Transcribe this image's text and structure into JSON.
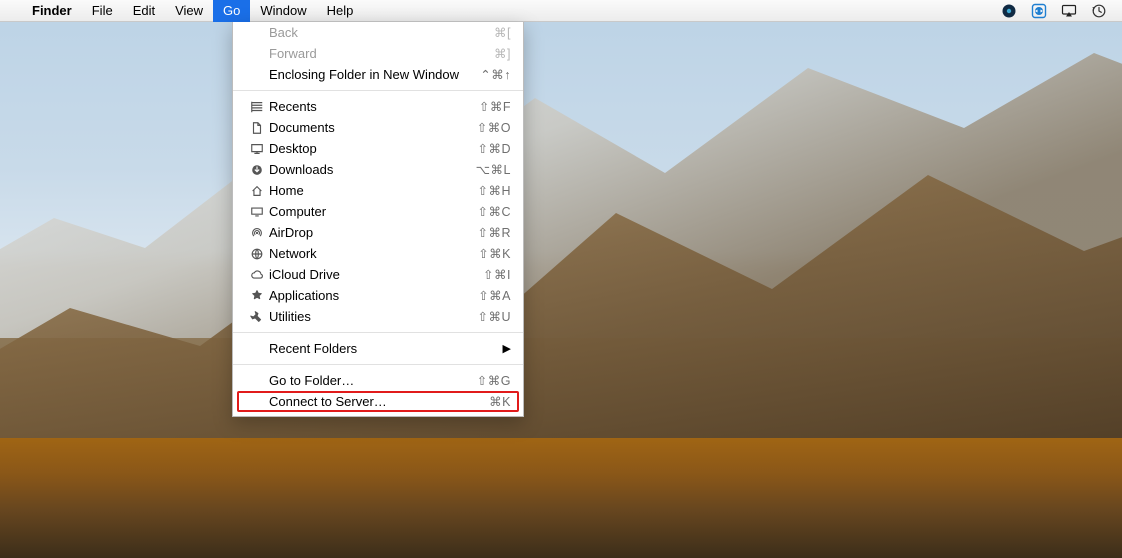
{
  "menubar": {
    "app": "Finder",
    "items": [
      "File",
      "Edit",
      "View",
      "Go",
      "Window",
      "Help"
    ],
    "active_index": 3
  },
  "dropdown": {
    "groups": [
      [
        {
          "label": "Back",
          "shortcut": "⌘[",
          "disabled": true,
          "icon": null
        },
        {
          "label": "Forward",
          "shortcut": "⌘]",
          "disabled": true,
          "icon": null
        },
        {
          "label": "Enclosing Folder in New Window",
          "shortcut": "⌃⌘↑",
          "disabled": false,
          "icon": null
        }
      ],
      [
        {
          "label": "Recents",
          "shortcut": "⇧⌘F",
          "icon": "recents"
        },
        {
          "label": "Documents",
          "shortcut": "⇧⌘O",
          "icon": "documents"
        },
        {
          "label": "Desktop",
          "shortcut": "⇧⌘D",
          "icon": "desktop"
        },
        {
          "label": "Downloads",
          "shortcut": "⌥⌘L",
          "icon": "downloads"
        },
        {
          "label": "Home",
          "shortcut": "⇧⌘H",
          "icon": "home"
        },
        {
          "label": "Computer",
          "shortcut": "⇧⌘C",
          "icon": "computer"
        },
        {
          "label": "AirDrop",
          "shortcut": "⇧⌘R",
          "icon": "airdrop"
        },
        {
          "label": "Network",
          "shortcut": "⇧⌘K",
          "icon": "network"
        },
        {
          "label": "iCloud Drive",
          "shortcut": "⇧⌘I",
          "icon": "icloud"
        },
        {
          "label": "Applications",
          "shortcut": "⇧⌘A",
          "icon": "applications"
        },
        {
          "label": "Utilities",
          "shortcut": "⇧⌘U",
          "icon": "utilities"
        }
      ],
      [
        {
          "label": "Recent Folders",
          "submenu": true,
          "icon": null
        }
      ],
      [
        {
          "label": "Go to Folder…",
          "shortcut": "⇧⌘G",
          "icon": null
        },
        {
          "label": "Connect to Server…",
          "shortcut": "⌘K",
          "icon": null,
          "highlight": true
        }
      ]
    ]
  }
}
